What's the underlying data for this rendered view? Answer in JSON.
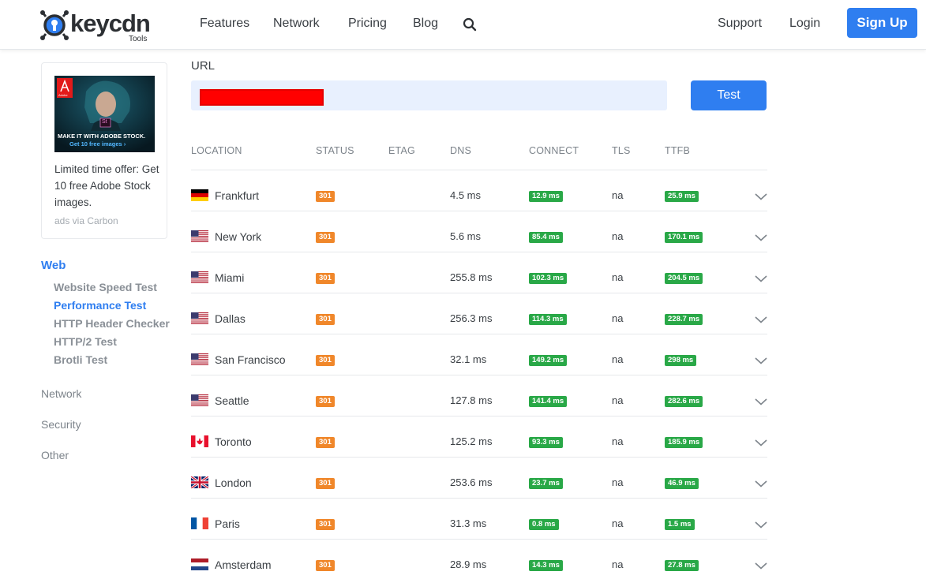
{
  "header": {
    "logo_word": "keycdn",
    "logo_sub": "Tools",
    "nav": [
      "Features",
      "Network",
      "Pricing",
      "Blog"
    ],
    "support": "Support",
    "login": "Login",
    "signup": "Sign Up"
  },
  "ad": {
    "image_headline": "MAKE IT WITH ADOBE STOCK.",
    "image_sub": "Get 10 free images ›",
    "image_brand": "Adobe",
    "image_badge": "St",
    "text": "Limited time offer: Get 10 free Adobe Stock images.",
    "via": "ads via Carbon"
  },
  "sidebar": {
    "web": "Web",
    "web_items": [
      "Website Speed Test",
      "Performance Test",
      "HTTP Header Checker",
      "HTTP/2 Test",
      "Brotli Test"
    ],
    "network": "Network",
    "security": "Security",
    "other": "Other"
  },
  "form": {
    "url_label": "URL",
    "url_value": "",
    "test_button": "Test"
  },
  "table": {
    "headers": [
      "LOCATION",
      "STATUS",
      "ETAG",
      "DNS",
      "CONNECT",
      "TLS",
      "TTFB"
    ],
    "rows": [
      {
        "flag": "de",
        "location": "Frankfurt",
        "status": "301",
        "dns": "4.5 ms",
        "connect": "12.9 ms",
        "tls": "na",
        "ttfb": "25.9 ms"
      },
      {
        "flag": "us",
        "location": "New York",
        "status": "301",
        "dns": "5.6 ms",
        "connect": "85.4 ms",
        "tls": "na",
        "ttfb": "170.1 ms"
      },
      {
        "flag": "us",
        "location": "Miami",
        "status": "301",
        "dns": "255.8 ms",
        "connect": "102.3 ms",
        "tls": "na",
        "ttfb": "204.5 ms"
      },
      {
        "flag": "us",
        "location": "Dallas",
        "status": "301",
        "dns": "256.3 ms",
        "connect": "114.3 ms",
        "tls": "na",
        "ttfb": "228.7 ms"
      },
      {
        "flag": "us",
        "location": "San Francisco",
        "status": "301",
        "dns": "32.1 ms",
        "connect": "149.2 ms",
        "tls": "na",
        "ttfb": "298 ms"
      },
      {
        "flag": "us",
        "location": "Seattle",
        "status": "301",
        "dns": "127.8 ms",
        "connect": "141.4 ms",
        "tls": "na",
        "ttfb": "282.6 ms"
      },
      {
        "flag": "ca",
        "location": "Toronto",
        "status": "301",
        "dns": "125.2 ms",
        "connect": "93.3 ms",
        "tls": "na",
        "ttfb": "185.9 ms"
      },
      {
        "flag": "gb",
        "location": "London",
        "status": "301",
        "dns": "253.6 ms",
        "connect": "23.7 ms",
        "tls": "na",
        "ttfb": "46.9 ms"
      },
      {
        "flag": "fr",
        "location": "Paris",
        "status": "301",
        "dns": "31.3 ms",
        "connect": "0.8 ms",
        "tls": "na",
        "ttfb": "1.5 ms"
      },
      {
        "flag": "nl",
        "location": "Amsterdam",
        "status": "301",
        "dns": "28.9 ms",
        "connect": "14.3 ms",
        "tls": "na",
        "ttfb": "27.8 ms"
      }
    ]
  },
  "colors": {
    "accent": "#2f7ef0",
    "status_badge": "#f0872a",
    "timing_badge": "#29a847"
  }
}
